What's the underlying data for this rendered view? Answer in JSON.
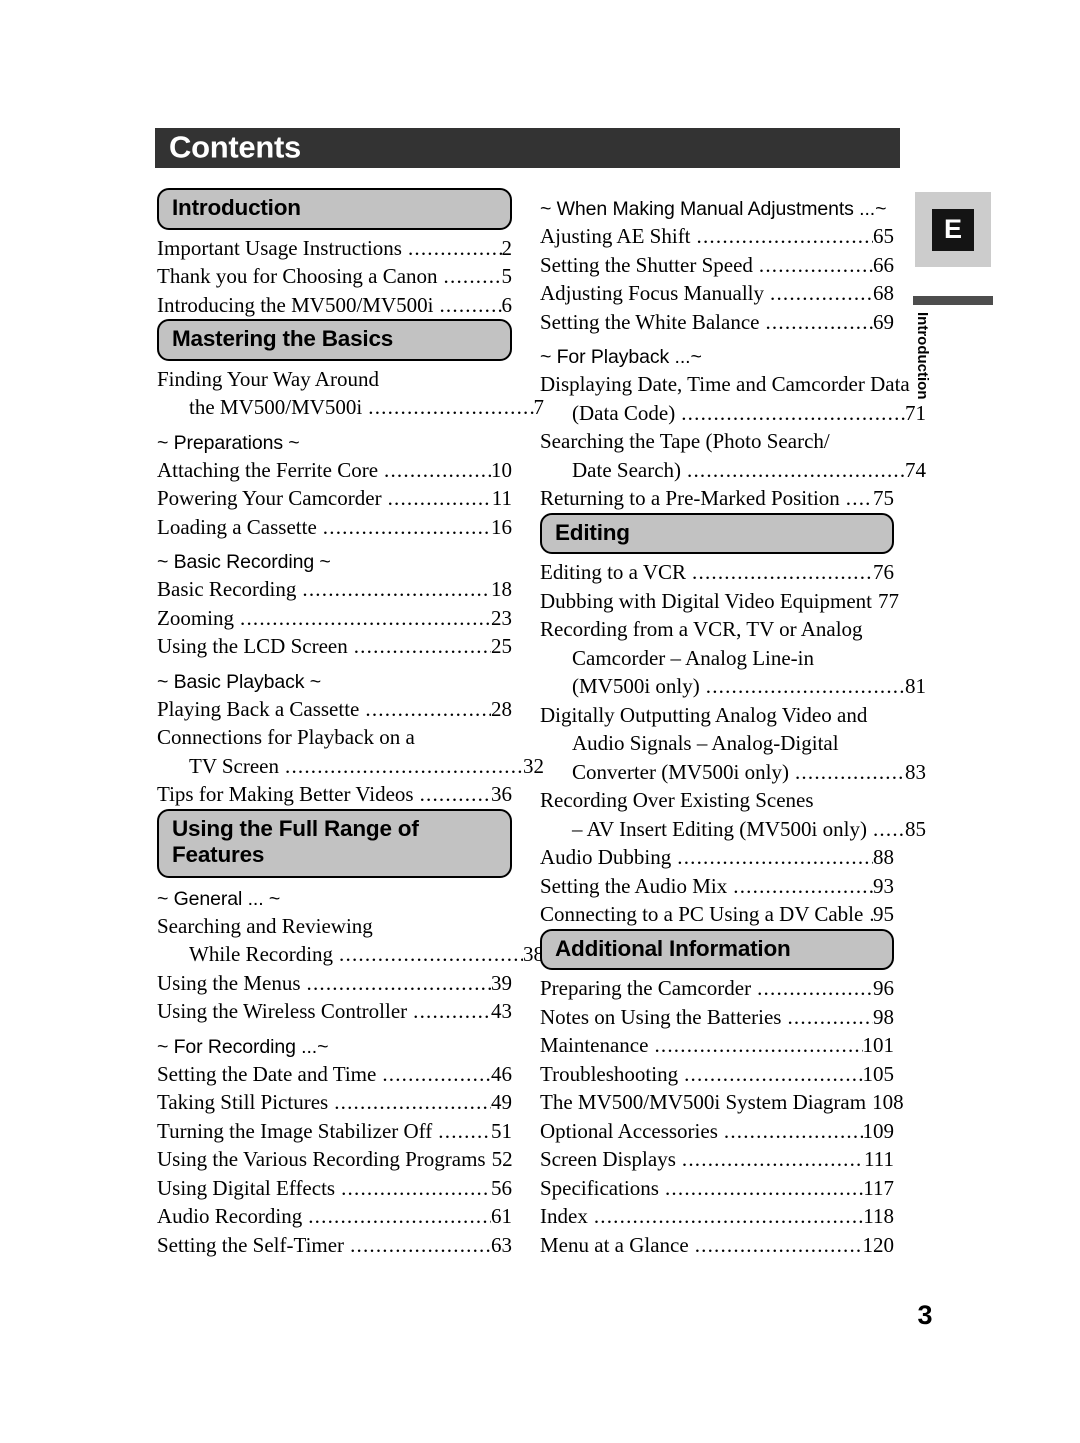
{
  "document": {
    "header_title": "Contents",
    "page_number": "3",
    "edition_badge": "E",
    "side_tab_label": "Introduction",
    "colors": {
      "header_bar": "#333333",
      "section_pill_fill": "#c2c2c2",
      "badge_box_fill": "#cccccc",
      "badge_inner_fill": "#141414",
      "tab_bar": "#4d4d4d"
    }
  },
  "columns": {
    "left": [
      {
        "kind": "section",
        "label": "Introduction",
        "entries": [
          {
            "text": "Important Usage Instructions",
            "page": "2"
          },
          {
            "text": "Thank you for Choosing a Canon",
            "page": "5"
          },
          {
            "text": "Introducing the MV500/MV500i",
            "page": "6"
          }
        ]
      },
      {
        "kind": "section",
        "label": "Mastering the Basics",
        "entries": [
          {
            "text": "Finding Your Way Around",
            "page": "",
            "leader": false
          },
          {
            "text": "the MV500/MV500i",
            "page": "7",
            "indent": true
          }
        ]
      },
      {
        "kind": "subheading",
        "label": "~ Preparations ~",
        "entries": [
          {
            "text": "Attaching the Ferrite Core",
            "page": "10"
          },
          {
            "text": "Powering Your Camcorder",
            "page": "11"
          },
          {
            "text": "Loading a Cassette",
            "page": "16"
          }
        ]
      },
      {
        "kind": "subheading",
        "label": "~ Basic Recording ~",
        "entries": [
          {
            "text": "Basic Recording",
            "page": "18"
          },
          {
            "text": "Zooming",
            "page": "23"
          },
          {
            "text": "Using the LCD Screen",
            "page": "25"
          }
        ]
      },
      {
        "kind": "subheading",
        "label": "~ Basic Playback ~",
        "entries": [
          {
            "text": "Playing Back a Cassette",
            "page": "28"
          },
          {
            "text": "Connections for Playback on a",
            "page": "",
            "leader": false
          },
          {
            "text": "TV Screen",
            "page": "32",
            "indent": true
          },
          {
            "text": "Tips for Making Better Videos",
            "page": "36"
          }
        ]
      },
      {
        "kind": "section",
        "label": "Using the Full Range of Features",
        "label_line1": "Using the Full Range of",
        "label_line2": "Features",
        "entries": []
      },
      {
        "kind": "subheading",
        "label": "~ General ... ~",
        "entries": [
          {
            "text": "Searching and Reviewing",
            "page": "",
            "leader": false
          },
          {
            "text": "While Recording",
            "page": "38",
            "indent": true
          },
          {
            "text": "Using the Menus",
            "page": "39"
          },
          {
            "text": "Using the Wireless Controller",
            "page": "43"
          }
        ]
      },
      {
        "kind": "subheading",
        "label": "~ For Recording ...~",
        "entries": [
          {
            "text": "Setting the Date and Time",
            "page": "46"
          },
          {
            "text": "Taking Still Pictures",
            "page": "49"
          },
          {
            "text": "Turning the Image Stabilizer Off",
            "page": "51"
          },
          {
            "text": "Using the Various Recording Programs",
            "page": "52"
          },
          {
            "text": "Using Digital Effects",
            "page": "56"
          },
          {
            "text": "Audio Recording",
            "page": "61"
          },
          {
            "text": "Setting the Self-Timer",
            "page": "63"
          }
        ]
      }
    ],
    "right": [
      {
        "kind": "subheading",
        "label": "~ When Making Manual Adjustments ...~",
        "entries": [
          {
            "text": "Ajusting AE Shift",
            "page": "65"
          },
          {
            "text": "Setting the Shutter Speed",
            "page": "66"
          },
          {
            "text": "Adjusting Focus Manually",
            "page": "68"
          },
          {
            "text": "Setting the White Balance",
            "page": "69"
          }
        ]
      },
      {
        "kind": "subheading",
        "label": "~ For Playback ...~",
        "entries": [
          {
            "text": "Displaying Date, Time and Camcorder Data",
            "page": "",
            "leader": false
          },
          {
            "text": "(Data Code)",
            "page": "71",
            "indent": true
          },
          {
            "text": "Searching the Tape (Photo Search/",
            "page": "",
            "leader": false
          },
          {
            "text": "Date Search)",
            "page": "74",
            "indent": true
          },
          {
            "text": "Returning to a Pre-Marked Position",
            "page": "75"
          }
        ]
      },
      {
        "kind": "section",
        "label": "Editing",
        "entries": [
          {
            "text": "Editing to a VCR",
            "page": "76"
          },
          {
            "text": "Dubbing with Digital Video Equipment",
            "page": "77"
          },
          {
            "text": "Recording from a VCR, TV or Analog",
            "page": "",
            "leader": false
          },
          {
            "text": "Camcorder – Analog Line-in",
            "page": "",
            "leader": false,
            "indent": true
          },
          {
            "text": "(MV500i only)",
            "page": "81",
            "indent": true
          },
          {
            "text": "Digitally Outputting Analog Video and",
            "page": "",
            "leader": false
          },
          {
            "text": "Audio Signals – Analog-Digital",
            "page": "",
            "leader": false,
            "indent": true
          },
          {
            "text": "Converter (MV500i only)",
            "page": "83",
            "indent": true
          },
          {
            "text": "Recording Over Existing Scenes",
            "page": "",
            "leader": false
          },
          {
            "text": "– AV Insert Editing (MV500i only)",
            "page": "85",
            "indent": true
          },
          {
            "text": "Audio Dubbing",
            "page": "88"
          },
          {
            "text": "Setting the Audio Mix",
            "page": "93"
          },
          {
            "text": "Connecting to a PC Using a DV Cable",
            "page": "95"
          }
        ]
      },
      {
        "kind": "section",
        "label": "Additional Information",
        "entries": [
          {
            "text": "Preparing the Camcorder",
            "page": "96"
          },
          {
            "text": "Notes on Using the Batteries",
            "page": "98"
          },
          {
            "text": "Maintenance",
            "page": "101"
          },
          {
            "text": "Troubleshooting",
            "page": "105"
          },
          {
            "text": "The MV500/MV500i System Diagram",
            "page": "108"
          },
          {
            "text": "Optional Accessories",
            "page": "109"
          },
          {
            "text": "Screen Displays",
            "page": "111"
          },
          {
            "text": "Specifications",
            "page": "117"
          },
          {
            "text": "Index",
            "page": "118"
          },
          {
            "text": "Menu at a Glance",
            "page": "120"
          }
        ]
      }
    ]
  }
}
